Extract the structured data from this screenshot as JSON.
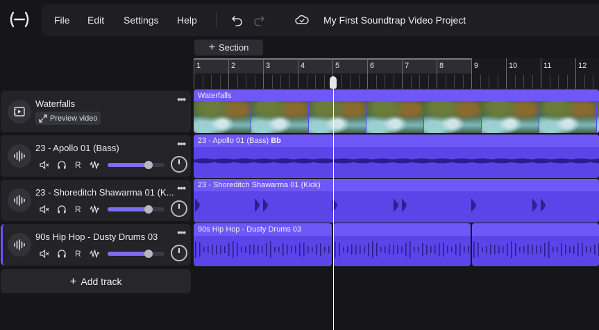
{
  "app": {
    "menu": [
      "File",
      "Edit",
      "Settings",
      "Help"
    ],
    "project_title": "My First Soundtrap Video Project"
  },
  "timeline": {
    "section_label": "Section",
    "bar_numbers": [
      "1",
      "2",
      "3",
      "4",
      "5",
      "6",
      "7",
      "8",
      "9",
      "10",
      "11",
      "12"
    ]
  },
  "tracks": [
    {
      "name": "Waterfalls",
      "type": "video",
      "preview_label": "Preview video",
      "clip_label": "Waterfalls"
    },
    {
      "name": "23 - Apollo 01 (Bass)",
      "type": "audio",
      "r_label": "R",
      "volume": 0.72,
      "clip_label": "23 - Apollo 01 (Bass)",
      "clip_key": "Bb"
    },
    {
      "name": "23 - Shoreditch Shawarma 01 (K...",
      "type": "audio",
      "r_label": "R",
      "volume": 0.72,
      "clip_label": "23 - Shoreditch Shawarma 01 (Kick)"
    },
    {
      "name": "90s Hip Hop - Dusty Drums 03",
      "type": "audio",
      "r_label": "R",
      "volume": 0.72,
      "clip_label": "90s Hip Hop - Dusty Drums 03",
      "selected": true
    }
  ],
  "add_track_label": "Add track",
  "colors": {
    "accent": "#6b55f5",
    "clip": "#5b45e8",
    "clip_header": "#6e58f7",
    "waveform": "#2a1e8a"
  },
  "icons": {
    "logo": "soundtrap-logo-icon",
    "undo": "undo-icon",
    "redo": "redo-icon",
    "cloud": "cloud-saved-icon",
    "video": "video-icon",
    "waveform": "waveform-icon",
    "mute": "mute-icon",
    "headphones": "solo-icon",
    "fx": "effects-icon",
    "more": "more-icon",
    "expand": "expand-icon",
    "plus": "plus-icon"
  }
}
